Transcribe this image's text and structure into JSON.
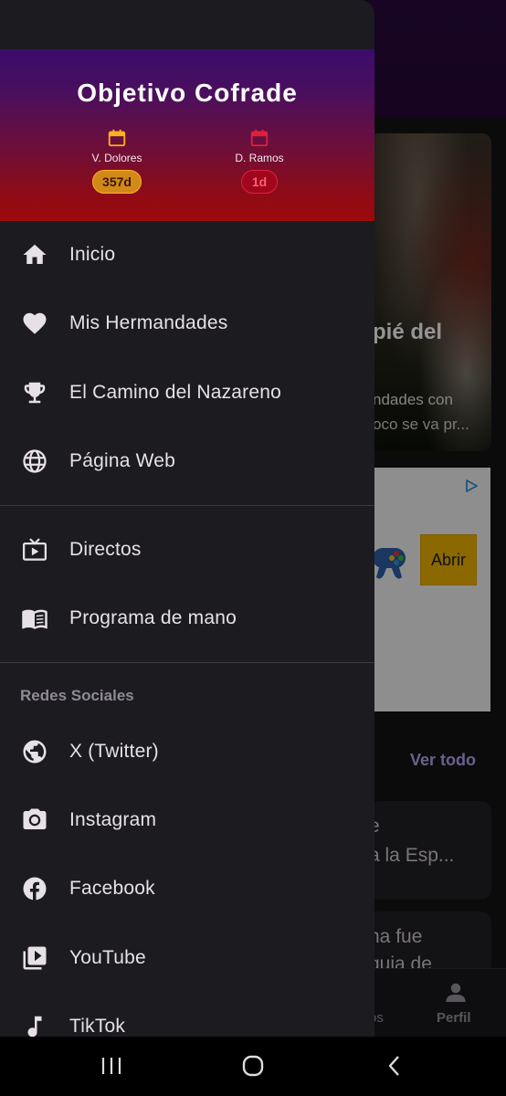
{
  "drawer": {
    "title": "Objetivo Cofrade",
    "countdowns": [
      {
        "label": "V. Dolores",
        "value": "357d",
        "icon": "calendar-icon",
        "color": "#ffb020"
      },
      {
        "label": "D. Ramos",
        "value": "1d",
        "icon": "calendar-icon",
        "color": "#e0203a"
      }
    ],
    "items": [
      {
        "label": "Inicio",
        "icon": "home-icon"
      },
      {
        "label": "Mis Hermandades",
        "icon": "heart-icon"
      },
      {
        "label": "El Camino del Nazareno",
        "icon": "trophy-icon"
      },
      {
        "label": "Página Web",
        "icon": "globe-icon"
      },
      {
        "label": "Directos",
        "icon": "live-tv-icon"
      },
      {
        "label": "Programa de mano",
        "icon": "book-icon"
      }
    ],
    "social_heading": "Redes Sociales",
    "social_items": [
      {
        "label": "X (Twitter)",
        "icon": "public-globe-icon"
      },
      {
        "label": "Instagram",
        "icon": "camera-icon"
      },
      {
        "label": "Facebook",
        "icon": "facebook-icon"
      },
      {
        "label": "YouTube",
        "icon": "video-library-icon"
      },
      {
        "label": "TikTok",
        "icon": "music-note-icon"
      }
    ]
  },
  "background": {
    "hero_title": "pié del",
    "hero_sub1": "ndades con",
    "hero_sub2": "oco se va pr...",
    "ad_button": "Abrir",
    "section_link": "Ver todo",
    "card1_line1": "e",
    "card1_line2": "a la Esp...",
    "card2_line1": "na fue",
    "card2_line2": "quia de",
    "nav_prev_label": "os",
    "nav_profile_label": "Perfil"
  },
  "colors": {
    "drawer_bg": "#1c1b1f",
    "header_top": "#3a0c6a",
    "header_bottom": "#9c0a0a",
    "accent_link": "#b8a8f0"
  }
}
